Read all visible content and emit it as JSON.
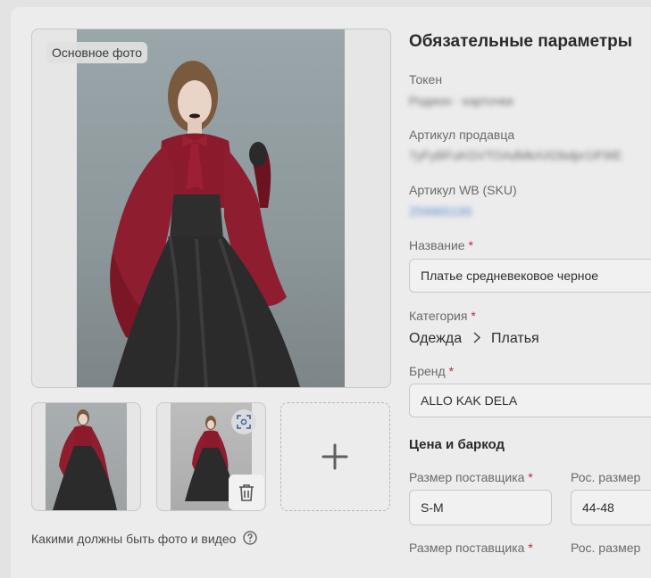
{
  "photos": {
    "main_badge": "Основное фото",
    "help_text": "Какими должны быть фото и видео"
  },
  "form": {
    "title": "Обязательные параметры",
    "token": {
      "label": "Токен",
      "value": "Родион · карточки"
    },
    "seller_article": {
      "label": "Артикул продавца",
      "value": "7yFyBFuKGVTOAdMkAXDbdpr1IF9IE"
    },
    "wb_article": {
      "label": "Артикул WB (SKU)",
      "value": "259965199"
    },
    "name": {
      "label": "Название",
      "required": "*",
      "value": "Платье средневековое черное"
    },
    "category": {
      "label": "Категория",
      "required": "*",
      "parent": "Одежда",
      "child": "Платья"
    },
    "brand": {
      "label": "Бренд",
      "required": "*",
      "value": "ALLO KAK DELA"
    },
    "price_section": "Цена и баркод",
    "supplier_size": {
      "label": "Размер поставщика",
      "required": "*",
      "value": "S-M"
    },
    "ru_size": {
      "label": "Рос. размер",
      "value": "44-48"
    },
    "supplier_size_2": {
      "label": "Размер поставщика",
      "required": "*"
    },
    "ru_size_2": {
      "label": "Рос. размер"
    }
  },
  "colors": {
    "required": "#c3263b",
    "dress_red": "#8a1a2c",
    "dress_black": "#2b2b2b"
  }
}
